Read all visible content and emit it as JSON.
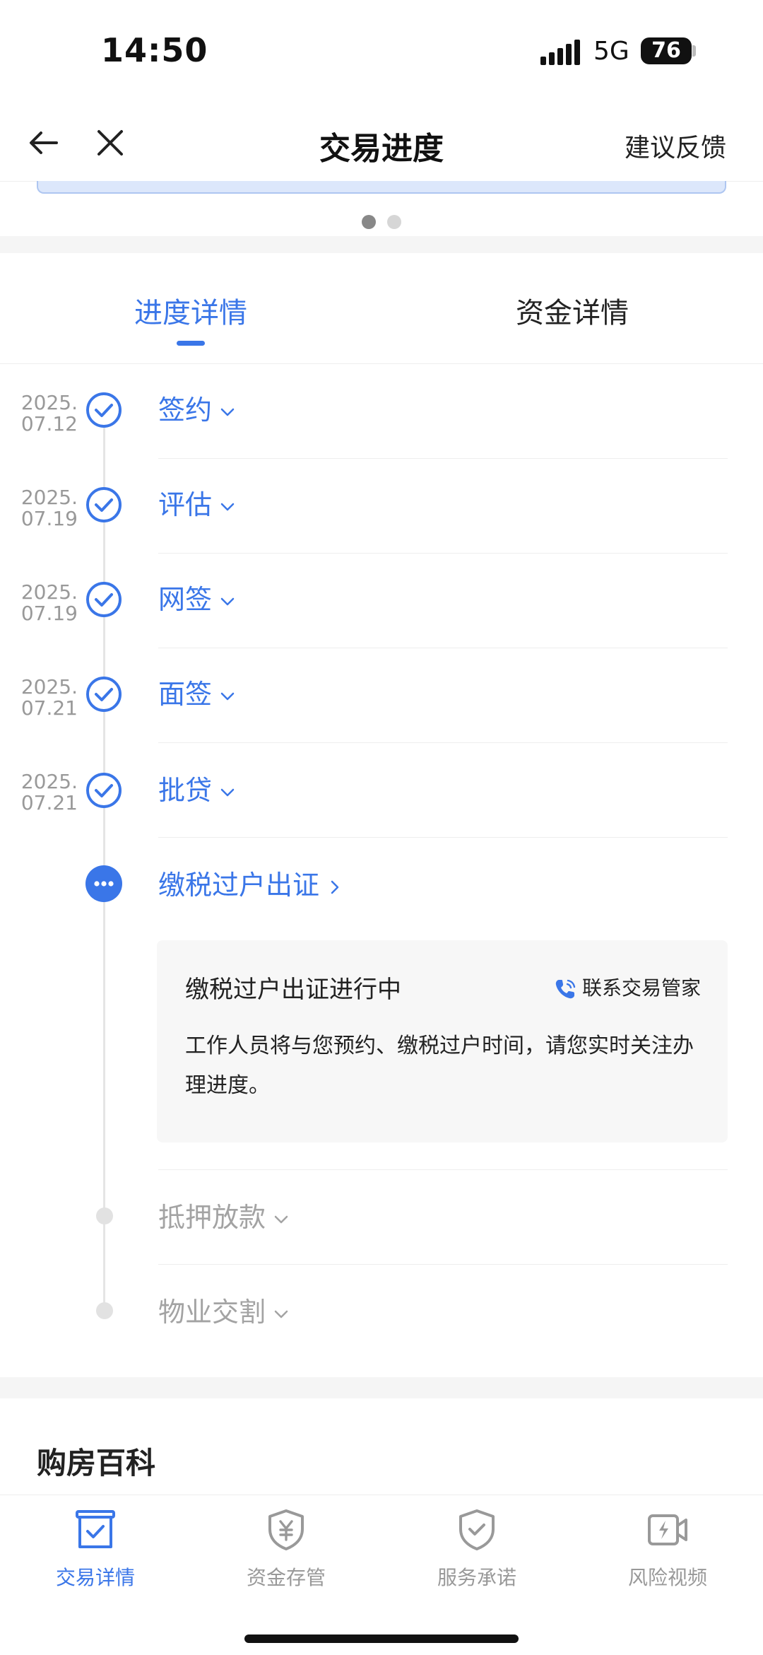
{
  "status_bar": {
    "time": "14:50",
    "network": "5G",
    "battery": "76"
  },
  "nav": {
    "title": "交易进度",
    "feedback": "建议反馈"
  },
  "tabs": [
    {
      "label": "进度详情",
      "active": true
    },
    {
      "label": "资金详情",
      "active": false
    }
  ],
  "timeline": {
    "steps": [
      {
        "date_year": "2025.",
        "date_day": "07.12",
        "label": "签约"
      },
      {
        "date_year": "2025.",
        "date_day": "07.19",
        "label": "评估"
      },
      {
        "date_year": "2025.",
        "date_day": "07.19",
        "label": "网签"
      },
      {
        "date_year": "2025.",
        "date_day": "07.21",
        "label": "面签"
      },
      {
        "date_year": "2025.",
        "date_day": "07.21",
        "label": "批贷"
      }
    ],
    "current": {
      "label": "缴税过户出证",
      "card_title": "缴税过户出证进行中",
      "contact": "联系交易管家",
      "description": "工作人员将与您预约、缴税过户时间，请您实时关注办理进度。"
    },
    "pending": [
      {
        "label": "抵押放款"
      },
      {
        "label": "物业交割"
      }
    ]
  },
  "encyclopedia": {
    "title": "购房百科"
  },
  "bottom_nav": [
    {
      "label": "交易详情",
      "icon": "transaction-detail-icon",
      "active": true
    },
    {
      "label": "资金存管",
      "icon": "fund-custody-shield-icon",
      "active": false
    },
    {
      "label": "服务承诺",
      "icon": "service-promise-shield-icon",
      "active": false
    },
    {
      "label": "风险视频",
      "icon": "risk-video-icon",
      "active": false
    }
  ],
  "colors": {
    "accent": "#3a76e8",
    "muted": "#999999",
    "pending": "#a3a3a3"
  }
}
